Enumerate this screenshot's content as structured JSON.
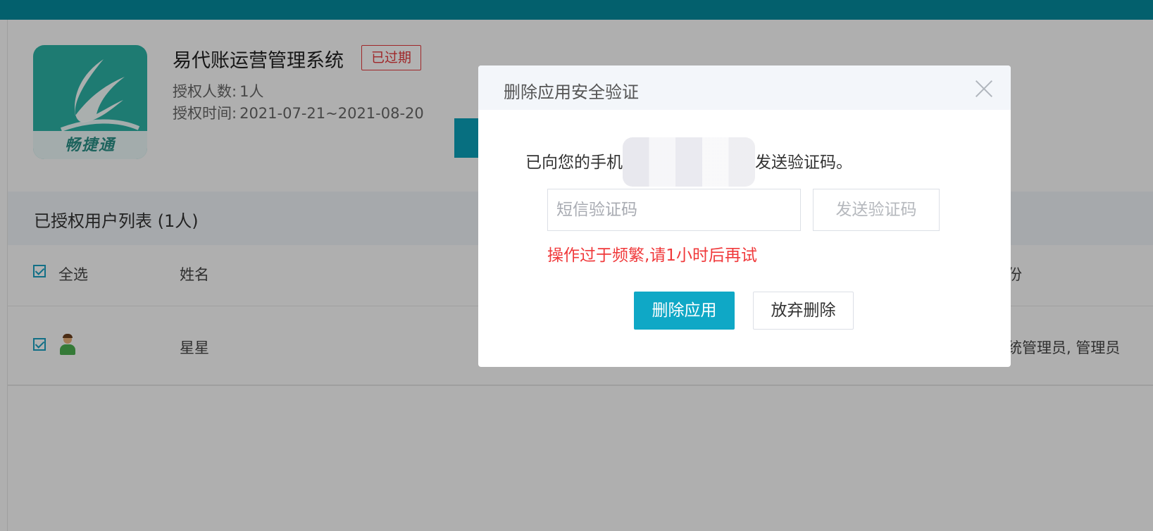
{
  "app": {
    "title": "易代账运营管理系统",
    "status_badge": "已过期",
    "icon_text": "畅捷通",
    "license_count_label": "授权人数:",
    "license_count_value": "1人",
    "license_time_label": "授权时间:",
    "license_time_value": "2021-07-21~2021-08-20"
  },
  "user_list": {
    "title": "已授权用户列表 (1人)",
    "select_all_label": "全选",
    "columns": {
      "name": "姓名",
      "role_partial": "份"
    },
    "rows": [
      {
        "name": "星星",
        "roles": "统管理员, 管理员",
        "checked": true
      }
    ]
  },
  "modal": {
    "title": "删除应用安全验证",
    "sent_prefix": "已向您的手机",
    "sent_suffix": "发送验证码。",
    "sms_input_placeholder": "短信验证码",
    "sms_input_value": "",
    "send_code_label": "发送验证码",
    "error_message": "操作过于频繁,请1小时后再试",
    "confirm_label": "删除应用",
    "cancel_label": "放弃删除"
  },
  "colors": {
    "topbar": "#058a9c",
    "primary": "#0fa8c6",
    "error": "#f0393b",
    "expired_badge": "#e4393c"
  },
  "icons": [
    "close-icon",
    "checkbox-checked-icon",
    "user-avatar-icon",
    "app-logo-icon"
  ]
}
